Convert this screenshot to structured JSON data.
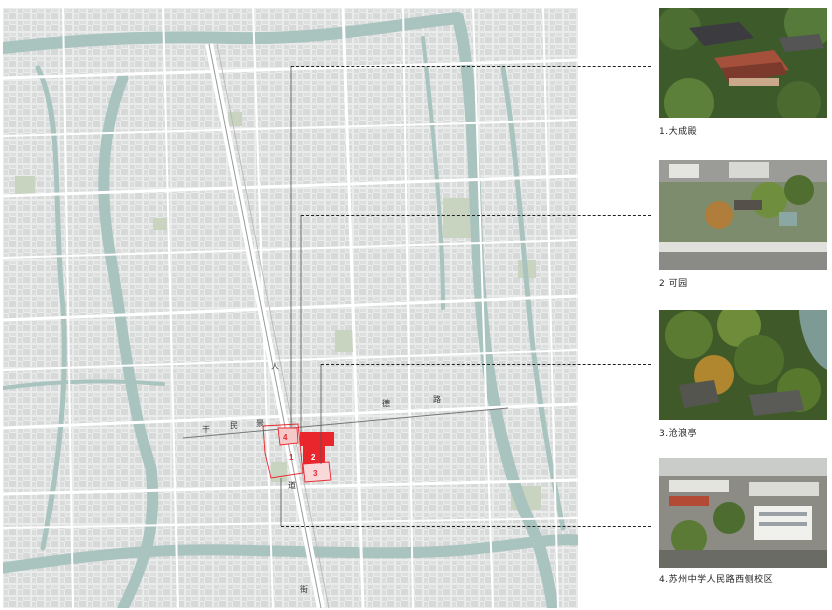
{
  "map": {
    "street_chars": [
      "人",
      "干",
      "民",
      "景",
      "德",
      "路",
      "道",
      "前",
      "街"
    ],
    "markers": [
      "1",
      "2",
      "3",
      "4"
    ],
    "colors": {
      "background": "#e9ecea",
      "block": "#d9dcda",
      "water": "#a9c3bf",
      "green": "#c5d1bd",
      "road": "#ffffff",
      "highlight": "#e8262c"
    }
  },
  "sites": [
    {
      "label": "1.大成殿",
      "photo": "temple-roof-photo"
    },
    {
      "label": "2 可园",
      "photo": "garden-aerial-photo"
    },
    {
      "label": "3.沧浪亭",
      "photo": "pavilion-trees-photo"
    },
    {
      "label": "4.苏州中学人民路西侧校区",
      "photo": "school-campus-photo"
    }
  ]
}
